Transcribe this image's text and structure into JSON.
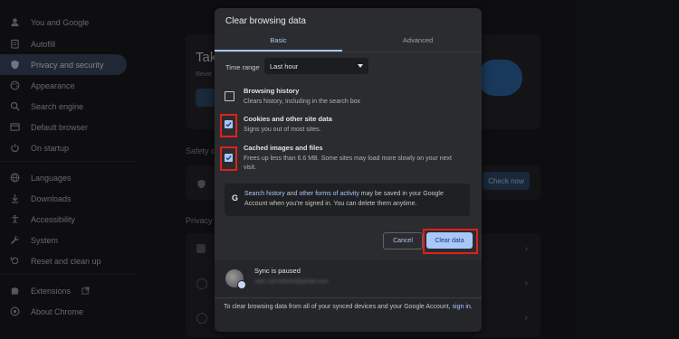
{
  "sidebar": {
    "items": [
      {
        "label": "You and Google",
        "icon": "person-icon"
      },
      {
        "label": "Autofill",
        "icon": "clipboard-icon"
      },
      {
        "label": "Privacy and security",
        "icon": "shield-icon",
        "active": true
      },
      {
        "label": "Appearance",
        "icon": "palette-icon"
      },
      {
        "label": "Search engine",
        "icon": "search-icon"
      },
      {
        "label": "Default browser",
        "icon": "browser-icon"
      },
      {
        "label": "On startup",
        "icon": "power-icon"
      },
      {
        "label": "Languages",
        "icon": "globe-icon"
      },
      {
        "label": "Downloads",
        "icon": "download-icon"
      },
      {
        "label": "Accessibility",
        "icon": "accessibility-icon"
      },
      {
        "label": "System",
        "icon": "wrench-icon"
      },
      {
        "label": "Reset and clean up",
        "icon": "reset-icon"
      },
      {
        "label": "Extensions",
        "icon": "puzzle-icon"
      },
      {
        "label": "About Chrome",
        "icon": "chrome-icon"
      }
    ]
  },
  "background": {
    "card_title": "Tak",
    "card_sub": "Revie",
    "safety_label": "Safety cl",
    "privacy_label": "Privacy a",
    "check_now": "Check now"
  },
  "dialog": {
    "title": "Clear browsing data",
    "tabs": {
      "basic": "Basic",
      "advanced": "Advanced"
    },
    "time_range": {
      "label": "Time range",
      "value": "Last hour"
    },
    "options": [
      {
        "title": "Browsing history",
        "subtitle": "Clears history, including in the search box",
        "checked": false
      },
      {
        "title": "Cookies and other site data",
        "subtitle": "Signs you out of most sites.",
        "checked": true
      },
      {
        "title": "Cached images and files",
        "subtitle": "Frees up less than 6.6 MB. Some sites may load more slowly on your next visit.",
        "checked": true
      }
    ],
    "info": {
      "link1": "Search history",
      "mid1": " and ",
      "link2": "other forms of activity",
      "rest": " may be saved in your Google Account when you're signed in. You can delete them anytime."
    },
    "buttons": {
      "cancel": "Cancel",
      "clear": "Clear data"
    },
    "sync": {
      "title": "Sync is paused",
      "email": "sam.samstfishe@gmail.com",
      "note": "To clear browsing data from all of your synced devices and your Google Account, ",
      "note_link": "sign in."
    }
  },
  "colors": {
    "accent": "#a8c7fa",
    "highlight": "#e0201b",
    "active_nav": "#3b4a63"
  }
}
